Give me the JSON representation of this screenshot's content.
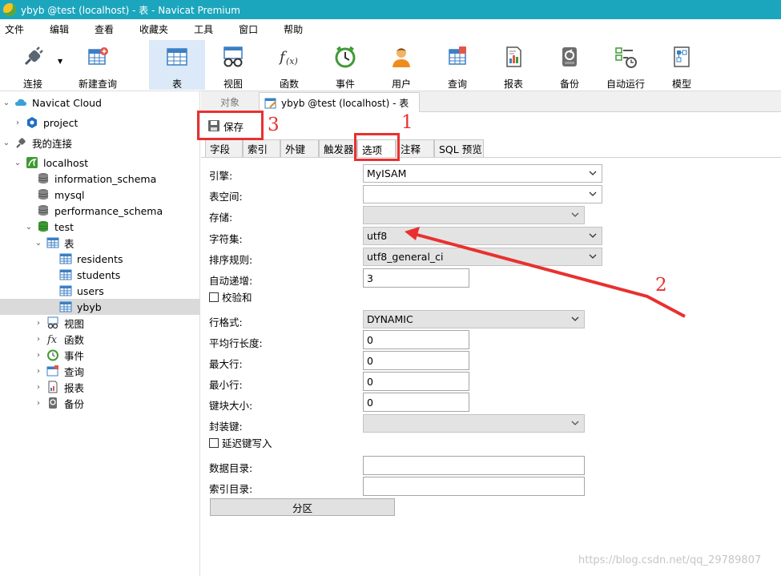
{
  "window": {
    "title": "ybyb @test (localhost) - 表 - Navicat Premium"
  },
  "menu": [
    "文件",
    "编辑",
    "查看",
    "收藏夹",
    "工具",
    "窗口",
    "帮助"
  ],
  "toolbar": {
    "items": [
      {
        "label": "连接",
        "icon": "plug-icon"
      },
      {
        "label": "新建查询",
        "icon": "new-query-icon"
      },
      {
        "label": "表",
        "icon": "table-icon",
        "active": true
      },
      {
        "label": "视图",
        "icon": "view-glasses-icon"
      },
      {
        "label": "函数",
        "icon": "function-fx-icon"
      },
      {
        "label": "事件",
        "icon": "event-clock-icon"
      },
      {
        "label": "用户",
        "icon": "user-icon"
      },
      {
        "label": "查询",
        "icon": "query-icon"
      },
      {
        "label": "报表",
        "icon": "report-icon"
      },
      {
        "label": "备份",
        "icon": "backup-icon"
      },
      {
        "label": "自动运行",
        "icon": "automation-icon"
      },
      {
        "label": "模型",
        "icon": "model-icon"
      }
    ]
  },
  "nav": {
    "cloud": "Navicat Cloud",
    "project": "project",
    "my_connections": "我的连接",
    "localhost": "localhost",
    "databases": [
      "information_schema",
      "mysql",
      "performance_schema"
    ],
    "test": "test",
    "tables_group": "表",
    "tables": [
      "residents",
      "students",
      "users",
      "ybyb"
    ],
    "selected_table": "ybyb",
    "groups": [
      "视图",
      "函数",
      "事件",
      "查询",
      "报表",
      "备份"
    ]
  },
  "tabs": {
    "objects": "对象",
    "designer": "ybyb @test (localhost) - 表"
  },
  "save_label": "保存",
  "subtabs": [
    "字段",
    "索引",
    "外键",
    "触发器",
    "选项",
    "注释",
    "SQL 预览"
  ],
  "active_subtab": "选项",
  "form": {
    "engine": {
      "label": "引擎:",
      "value": "MyISAM"
    },
    "tablespace": {
      "label": "表空间:",
      "value": ""
    },
    "storage": {
      "label": "存储:",
      "value": ""
    },
    "charset": {
      "label": "字符集:",
      "value": "utf8"
    },
    "collation": {
      "label": "排序规则:",
      "value": "utf8_general_ci"
    },
    "auto_increment": {
      "label": "自动递增:",
      "value": "3"
    },
    "checksum": {
      "label": "校验和",
      "checked": false
    },
    "row_format": {
      "label": "行格式:",
      "value": "DYNAMIC"
    },
    "avg_row_length": {
      "label": "平均行长度:",
      "value": "0"
    },
    "max_rows": {
      "label": "最大行:",
      "value": "0"
    },
    "min_rows": {
      "label": "最小行:",
      "value": "0"
    },
    "key_block_size": {
      "label": "键块大小:",
      "value": "0"
    },
    "packed_keys": {
      "label": "封装键:",
      "value": ""
    },
    "delay_key_write": {
      "label": "延迟键写入",
      "checked": false
    },
    "data_directory": {
      "label": "数据目录:",
      "value": ""
    },
    "index_directory": {
      "label": "索引目录:",
      "value": ""
    },
    "partition_button": "分区"
  },
  "annotations": {
    "n1": "1",
    "n2": "2",
    "n3": "3",
    "color": "#e8312f"
  },
  "watermark": "https://blog.csdn.net/qq_29789807"
}
